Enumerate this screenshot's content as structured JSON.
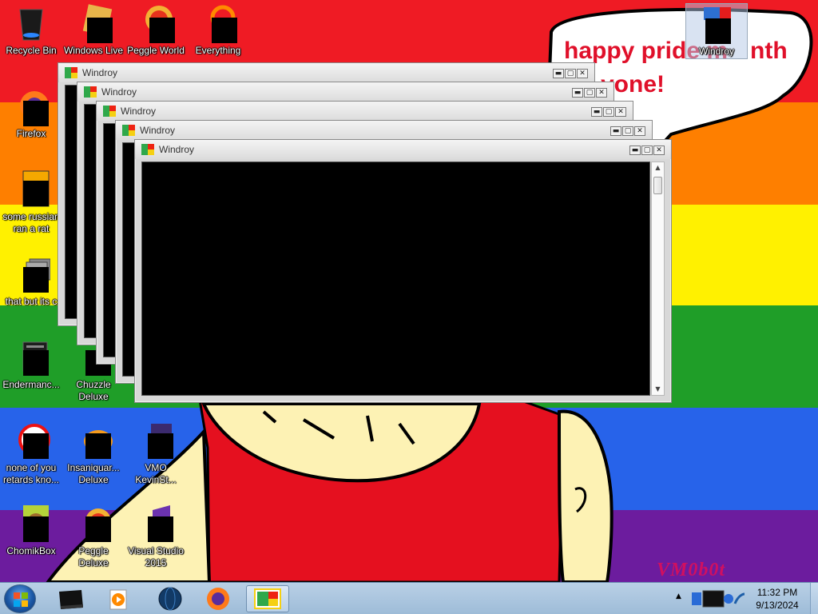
{
  "wallpaper": {
    "bubble_line1": "happy pride m",
    "bubble_line1_end": "nth",
    "bubble_line2": "yone!",
    "signature": "VM0b0t",
    "colors": {
      "red": "#ef1b24",
      "orange": "#fe7f00",
      "yellow": "#fff100",
      "green": "#1f9e28",
      "blue": "#2763ea",
      "purple": "#6c1c9e",
      "text": "#e0102a",
      "skin": "#fdf2b4"
    }
  },
  "desktop_icons": [
    {
      "label": "Recycle Bin",
      "icon": "recycle-bin-icon"
    },
    {
      "label": "Windows Live",
      "icon": "windows-live-icon"
    },
    {
      "label": "Peggle World",
      "icon": "peggle-world-icon"
    },
    {
      "label": "Everything",
      "icon": "everything-search-icon"
    },
    {
      "label": "Windroy",
      "icon": "windroy-icon"
    },
    {
      "label": "Firefox",
      "icon": "firefox-icon"
    },
    {
      "label": "some russian ran a rat",
      "icon": "shortcut-icon"
    },
    {
      "label": "that but its c",
      "icon": "folder-stack-icon"
    },
    {
      "label": "Endermanc...",
      "icon": "application-icon"
    },
    {
      "label": "Chuzzle Deluxe",
      "icon": "chuzzle-icon"
    },
    {
      "label": "none of you retards kno...",
      "icon": "red-circle-icon"
    },
    {
      "label": "Insaniquar... Deluxe",
      "icon": "insaniquarium-icon"
    },
    {
      "label": "VMO KevinSt...",
      "icon": "vmo-icon"
    },
    {
      "label": "ChomikBox",
      "icon": "chomikbox-icon"
    },
    {
      "label": "Peggle Deluxe",
      "icon": "peggle-deluxe-icon"
    },
    {
      "label": "Visual Studio 2015",
      "icon": "visual-studio-icon"
    }
  ],
  "windows": [
    {
      "title": "Windroy"
    },
    {
      "title": "Windroy"
    },
    {
      "title": "Windroy"
    },
    {
      "title": "Windroy"
    },
    {
      "title": "Windroy"
    }
  ],
  "window_controls": {
    "minimize": "▬",
    "maximize": "▢",
    "close": "✕"
  },
  "taskbar": {
    "pinned": [
      {
        "icon": "media-center-icon"
      },
      {
        "icon": "media-player-icon"
      },
      {
        "icon": "globe-browser-icon"
      },
      {
        "icon": "firefox-icon"
      },
      {
        "icon": "windroy-icon",
        "active": true
      }
    ],
    "clock_time": "11:32 PM",
    "clock_date": "9/13/2024"
  }
}
